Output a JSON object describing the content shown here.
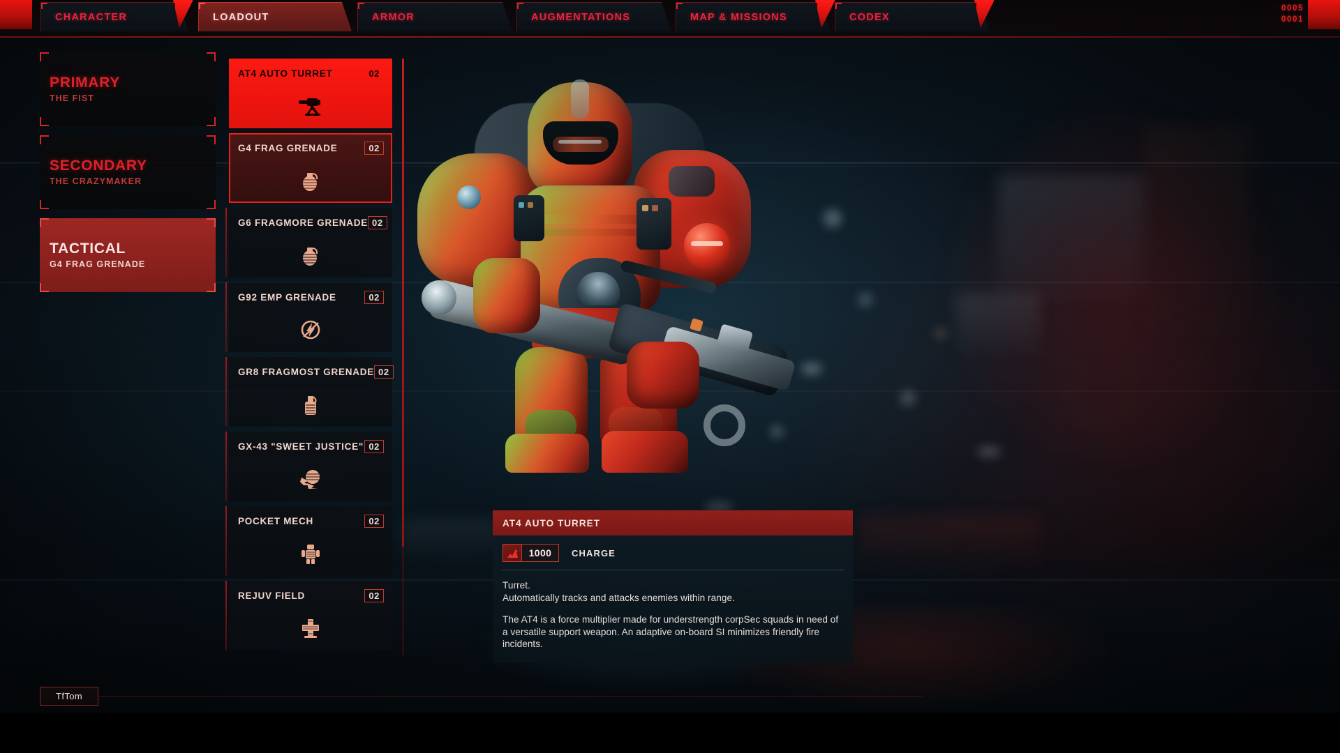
{
  "tabs": [
    {
      "label": "CHARACTER",
      "active": false,
      "flag": true
    },
    {
      "label": "LOADOUT",
      "active": true,
      "flag": false
    },
    {
      "label": "ARMOR",
      "active": false,
      "flag": false
    },
    {
      "label": "AUGMENTATIONS",
      "active": false,
      "flag": false
    },
    {
      "label": "MAP & MISSIONS",
      "active": false,
      "flag": true
    },
    {
      "label": "CODEX",
      "active": false,
      "flag": true
    }
  ],
  "counters": {
    "top": "0005",
    "bottom": "0001"
  },
  "slots": [
    {
      "title": "PRIMARY",
      "sub": "THE FIST",
      "selected": false
    },
    {
      "title": "SECONDARY",
      "sub": "THE CRAZYMAKER",
      "selected": false
    },
    {
      "title": "TACTICAL",
      "sub": "G4 FRAG GRENADE",
      "selected": true
    }
  ],
  "items": [
    {
      "name": "AT4 AUTO TURRET",
      "qty": "02",
      "icon": "turret-icon",
      "state": "hover"
    },
    {
      "name": "G4 FRAG GRENADE",
      "qty": "02",
      "icon": "grenade-icon",
      "state": "equipped"
    },
    {
      "name": "G6 FRAGMORE GRENADE",
      "qty": "02",
      "icon": "grenade-icon",
      "state": "normal"
    },
    {
      "name": "G92 EMP GRENADE",
      "qty": "02",
      "icon": "emp-icon",
      "state": "normal"
    },
    {
      "name": "GR8 FRAGMOST GRENADE",
      "qty": "02",
      "icon": "canister-icon",
      "state": "normal"
    },
    {
      "name": "GX-43 \"SWEET JUSTICE\"",
      "qty": "02",
      "icon": "shockwave-icon",
      "state": "normal"
    },
    {
      "name": "POCKET MECH",
      "qty": "02",
      "icon": "mech-icon",
      "state": "normal"
    },
    {
      "name": "REJUV FIELD",
      "qty": "02",
      "icon": "cross-icon",
      "state": "normal"
    }
  ],
  "info": {
    "title": "AT4 AUTO TURRET",
    "stat_value": "1000",
    "stat_label": "CHARGE",
    "desc_line1": "Turret.",
    "desc_line2": "Automatically tracks and attacks enemies within range.",
    "desc_flavor": "The AT4 is a force multiplier made for understrength corpSec squads in need of a versatile support weapon. An adaptive on-board SI minimizes friendly fire incidents."
  },
  "footer": {
    "tag": "TfTom"
  },
  "colors": {
    "accent_red": "#e0202a",
    "hover_red": "#f4150f",
    "selected_red": "#9e2722",
    "panel_dark": "#0b0f14",
    "text_light": "#f1d6cc"
  }
}
